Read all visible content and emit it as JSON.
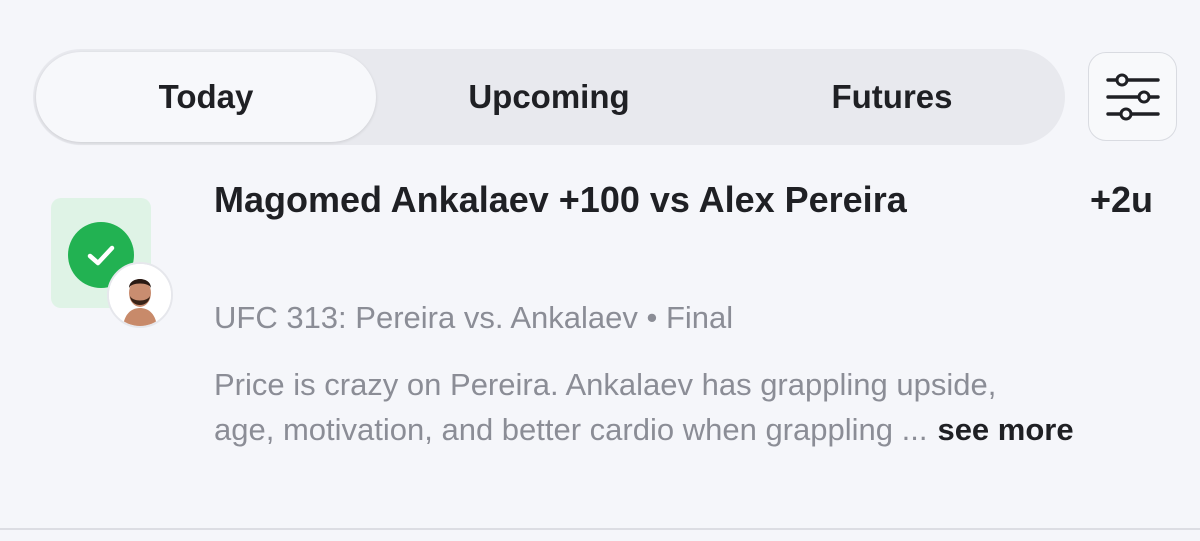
{
  "tabs": {
    "items": [
      {
        "label": "Today",
        "selected": true
      },
      {
        "label": "Upcoming",
        "selected": false
      },
      {
        "label": "Futures",
        "selected": false
      }
    ],
    "filter_icon": "sliders-icon"
  },
  "pick": {
    "title": "Magomed Ankalaev +100 vs Alex Pereira",
    "units": "+2u",
    "event": "UFC 313: Pereira vs. Ankalaev",
    "separator": "•",
    "status": "Final",
    "result": "win",
    "result_icon": "check-icon",
    "note_line1": "Price is crazy on Pereira. Ankalaev has grappling upside,",
    "note_line2": "age, motivation, and better cardio when grappling ...",
    "see_more": "see more"
  },
  "colors": {
    "win_green": "#22b252",
    "win_bg": "#dff3e6",
    "muted_text": "#8b8d96",
    "primary_text": "#1f2024"
  }
}
